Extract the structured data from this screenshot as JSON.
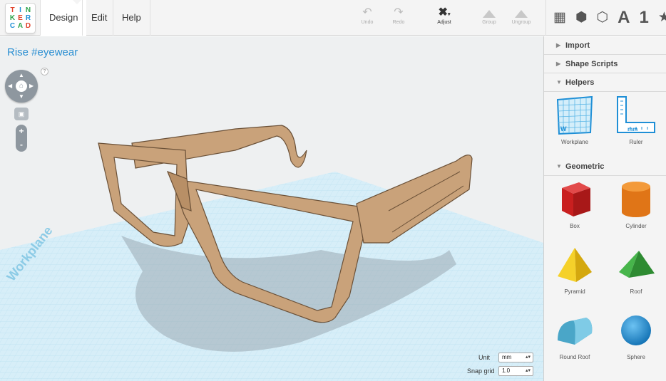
{
  "app": {
    "logo_letters": [
      "T",
      "I",
      "N",
      "K",
      "E",
      "R",
      "C",
      "A",
      "D"
    ],
    "menu": {
      "design": "Design",
      "edit": "Edit",
      "help": "Help"
    },
    "toolbar": {
      "undo": "Undo",
      "redo": "Redo",
      "adjust": "Adjust",
      "group": "Group",
      "ungroup": "Ungroup"
    },
    "view_icons": [
      "grid-icon",
      "solid-cube-icon",
      "wire-cube-icon",
      "text-icon",
      "number-icon",
      "star-icon"
    ],
    "view_text": {
      "letter": "A",
      "number": "1"
    }
  },
  "canvas": {
    "design_title": "Rise #eyewear",
    "help": "?",
    "workplane_label": "Workplane",
    "zoom": {
      "in": "+",
      "out": "-"
    },
    "unit": {
      "label": "Unit",
      "value": "mm"
    },
    "snap": {
      "label": "Snap grid",
      "value": "1.0"
    }
  },
  "panel": {
    "sections": {
      "import": "Import",
      "shape_scripts": "Shape Scripts",
      "helpers": "Helpers",
      "geometric": "Geometric"
    },
    "helpers": [
      {
        "label": "Workplane",
        "badge": "W"
      },
      {
        "label": "Ruler",
        "badge": "mm"
      }
    ],
    "geometric": [
      {
        "label": "Box",
        "color": "#d42a2a"
      },
      {
        "label": "Cylinder",
        "color": "#e87a1a"
      },
      {
        "label": "Pyramid",
        "color": "#f2c71a"
      },
      {
        "label": "Roof",
        "color": "#3aa83f"
      },
      {
        "label": "Round Roof",
        "color": "#5bb6d6"
      },
      {
        "label": "Sphere",
        "color": "#1f8fd6"
      }
    ]
  },
  "colors": {
    "accent": "#2b8fd2",
    "glasses": "#c9a27a",
    "grid": "#9fd3ea"
  }
}
